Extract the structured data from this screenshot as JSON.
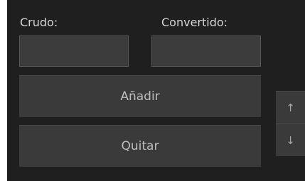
{
  "labels": {
    "raw": "Crudo:",
    "converted": "Convertido:"
  },
  "fields": {
    "raw_value": "",
    "converted_value": ""
  },
  "buttons": {
    "add": "Añadir",
    "remove": "Quitar",
    "move_up": "↑",
    "move_down": "↓"
  },
  "colors": {
    "panel_background": "#1f1f1f",
    "field_background": "#3c3c3c",
    "button_background": "#3a3a3a",
    "label_text": "#d6d6d6",
    "button_text": "#bdbdbd"
  }
}
